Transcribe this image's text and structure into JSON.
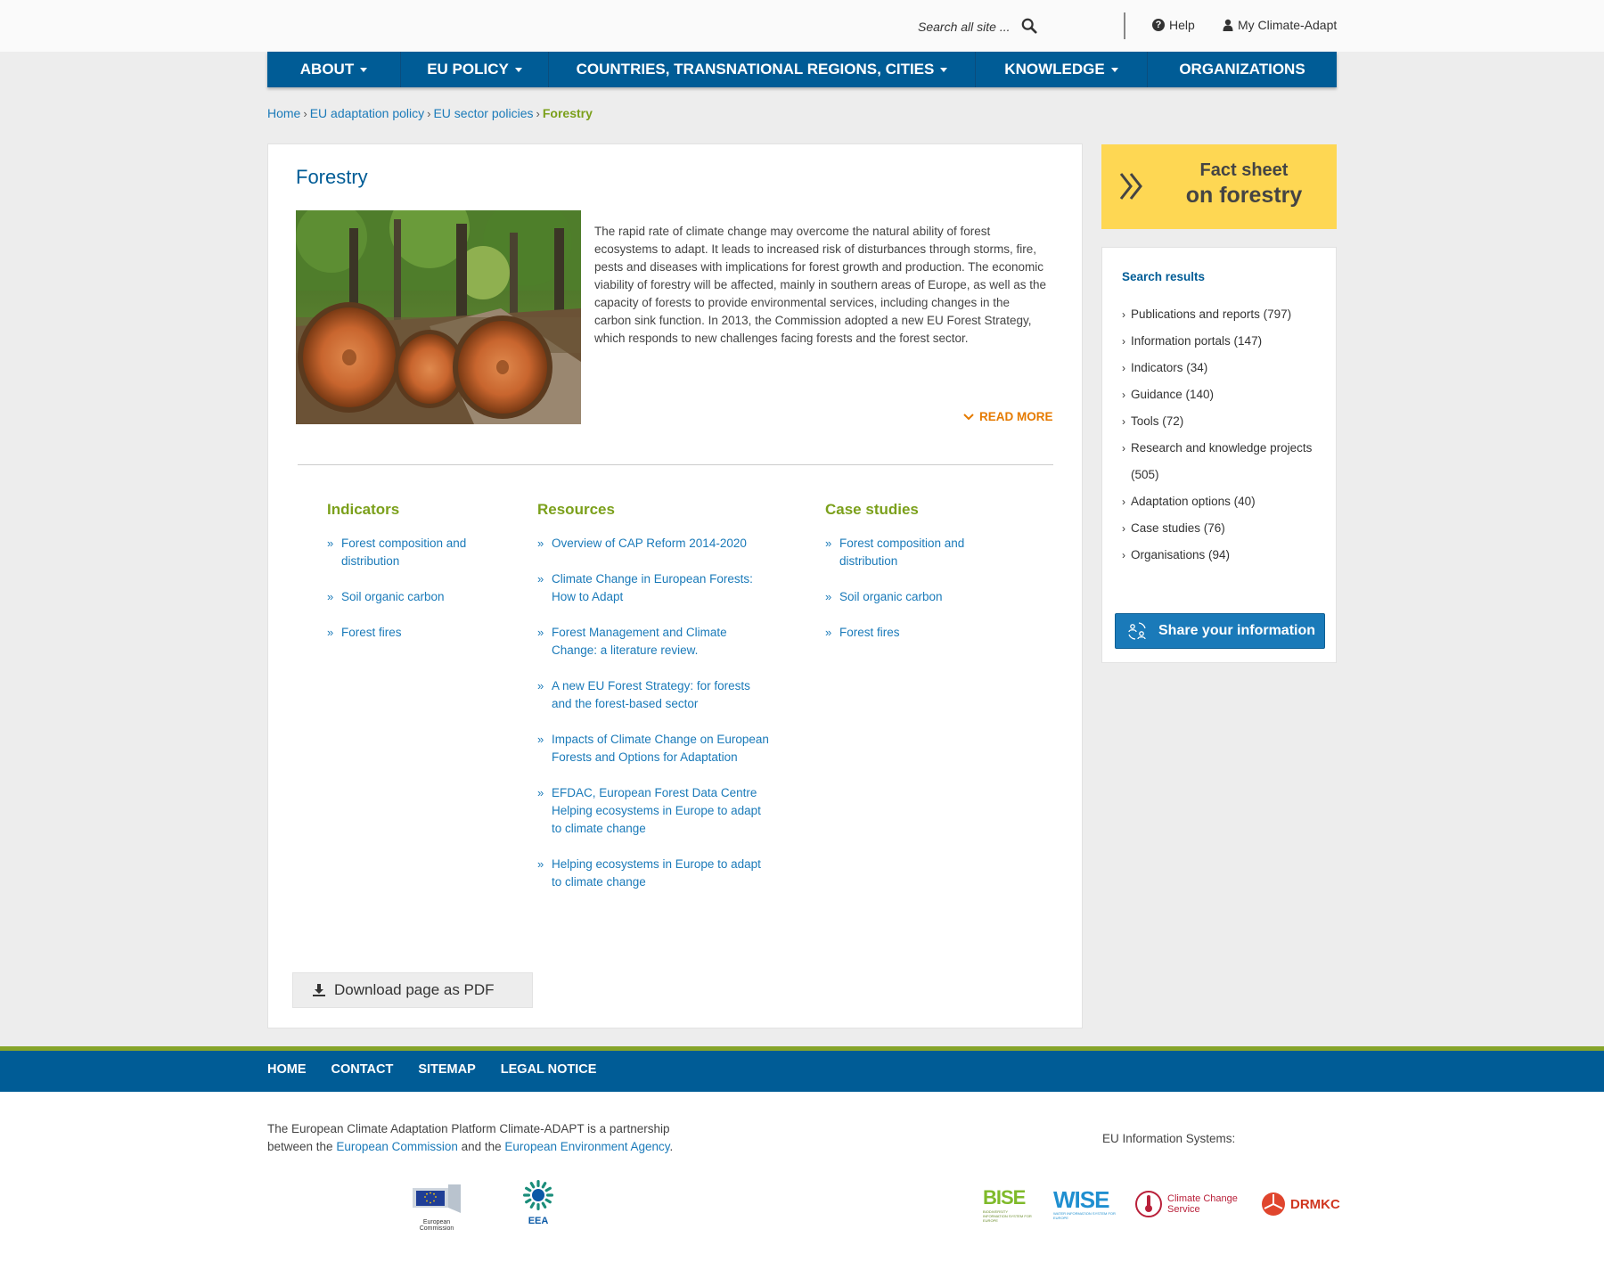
{
  "topbar": {
    "search_placeholder": "Search all site ...",
    "help_label": "Help",
    "account_label": "My Climate-Adapt"
  },
  "nav": {
    "items": [
      {
        "label": "ABOUT",
        "has_dropdown": true
      },
      {
        "label": "EU POLICY",
        "has_dropdown": true
      },
      {
        "label": "COUNTRIES, TRANSNATIONAL REGIONS, CITIES",
        "has_dropdown": true
      },
      {
        "label": "KNOWLEDGE",
        "has_dropdown": true
      },
      {
        "label": "ORGANIZATIONS",
        "has_dropdown": false
      }
    ]
  },
  "breadcrumb": {
    "items": [
      "Home",
      "EU adaptation policy",
      "EU sector policies"
    ],
    "current": "Forestry"
  },
  "main": {
    "title": "Forestry",
    "intro": "The rapid rate of climate change may overcome the natural ability of forest ecosystems to adapt. It leads to increased risk of disturbances through storms, fire, pests and diseases with implications for forest growth and production. The economic viability of forestry will be affected, mainly in southern areas of Europe, as well as the capacity of forests to provide environmental services, including changes in the carbon sink function. In 2013, the Commission adopted a new EU Forest Strategy, which responds to new challenges facing forests and the forest sector.",
    "read_more": "READ MORE",
    "indicators": {
      "title": "Indicators",
      "items": [
        "Forest composition and distribution",
        "Soil organic carbon",
        "Forest fires"
      ]
    },
    "resources": {
      "title": "Resources",
      "items": [
        "Overview of CAP Reform 2014-2020",
        "Climate Change in European Forests: How to Adapt",
        "Forest Management and Climate Change: a literature review.",
        "A new EU Forest Strategy: for forests and the forest-based sector",
        "Impacts of Climate Change on European Forests and Options for Adaptation",
        "EFDAC, European Forest Data Centre Helping ecosystems in Europe to adapt to climate change",
        "Helping ecosystems in Europe to adapt to climate change"
      ]
    },
    "case_studies": {
      "title": "Case studies",
      "items": [
        "Forest composition and distribution",
        "Soil organic carbon",
        "Forest fires"
      ]
    },
    "pdf_button": "Download page as PDF"
  },
  "sidebar": {
    "factsheet_line1": "Fact sheet",
    "factsheet_line2": "on forestry",
    "search_results_title": "Search results",
    "results": [
      "Publications and reports (797)",
      "Information portals (147)",
      "Indicators (34)",
      "Guidance (140)",
      "Tools (72)",
      "Research and knowledge projects (505)",
      "Adaptation options (40)",
      "Case studies (76)",
      "Organisations (94)"
    ],
    "share_button": "Share your information"
  },
  "footer": {
    "links": [
      "HOME",
      "CONTACT",
      "SITEMAP",
      "LEGAL NOTICE"
    ],
    "partner_text_1": "The European Climate Adaptation Platform Climate-ADAPT is a partnership between the ",
    "partner_link_1": "European Commission",
    "partner_text_2": " and the ",
    "partner_link_2": "European Environment Agency",
    "partner_text_3": ".",
    "eu_info_label": "EU Information Systems:",
    "logos": {
      "ec_caption": "European Commission",
      "eea": "EEA",
      "bise": "BISE",
      "bise_caption": "BIODIVERSITY INFORMATION SYSTEM FOR EUROPE",
      "wise": "WISE",
      "wise_caption": "WATER INFORMATION SYSTEM FOR EUROPE",
      "ccs_line1": "Climate Change",
      "ccs_line2": "Service",
      "drmkc": "DRMKC"
    }
  },
  "colors": {
    "brand_blue": "#005c96",
    "link_blue": "#1a7ab9",
    "accent_green": "#7ba01b",
    "accent_orange": "#e57a00",
    "factsheet_yellow": "#fed753"
  }
}
